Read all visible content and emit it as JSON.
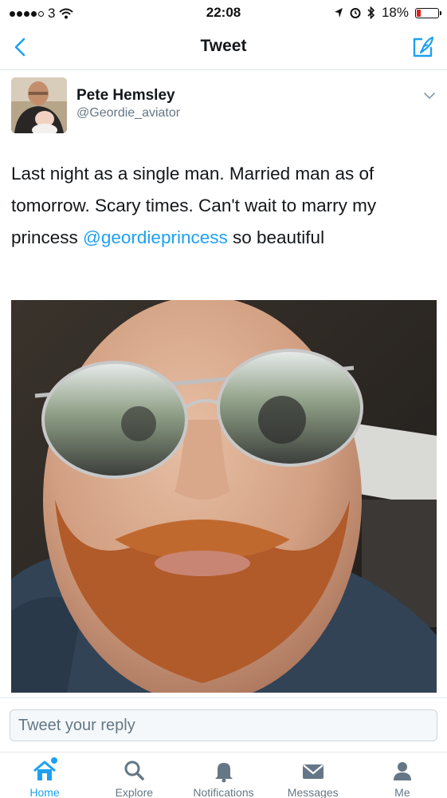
{
  "status_bar": {
    "carrier": "3",
    "time": "22:08",
    "battery_percent": "18%",
    "battery_level": 0.18,
    "icons": [
      "signal-dots-icon",
      "wifi-icon",
      "location-arrow-icon",
      "alarm-icon",
      "bluetooth-icon",
      "battery-icon"
    ]
  },
  "nav": {
    "title": "Tweet",
    "back_icon": "chevron-left-icon",
    "compose_icon": "compose-tweet-icon"
  },
  "tweet": {
    "author_name": "Pete Hemsley",
    "author_handle": "@Geordie_aviator",
    "text_before": "Last night as a single man. Married man as of tomorrow. Scary times. Can't wait to marry my princess ",
    "mention": "@geordieprincess",
    "text_after": " so beautiful",
    "caret_icon": "chevron-down-icon"
  },
  "reply": {
    "placeholder": "Tweet your reply"
  },
  "tabs": [
    {
      "label": "Home",
      "icon": "home-icon",
      "active": true
    },
    {
      "label": "Explore",
      "icon": "search-icon",
      "active": false
    },
    {
      "label": "Notifications",
      "icon": "bell-icon",
      "active": false
    },
    {
      "label": "Messages",
      "icon": "envelope-icon",
      "active": false
    },
    {
      "label": "Me",
      "icon": "person-icon",
      "active": false
    }
  ],
  "colors": {
    "accent": "#1da1f2",
    "text": "#14171a",
    "secondary": "#657786",
    "battery_low": "#e0201b"
  }
}
